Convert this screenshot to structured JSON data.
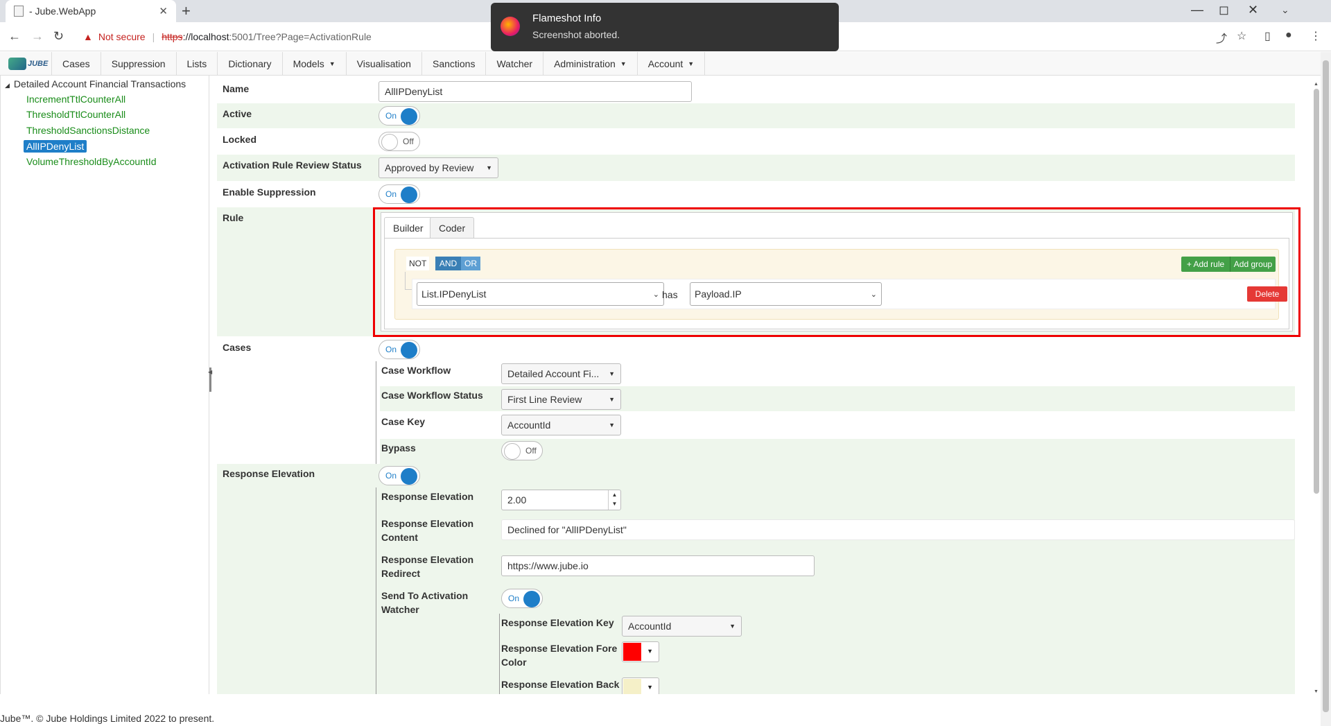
{
  "browser": {
    "tab_title": "- Jube.WebApp",
    "new_tab": "+",
    "url_warning": "Not secure",
    "url_scheme": "https",
    "url_host": "://localhost",
    "url_path": ":5001/Tree?Page=ActivationRule"
  },
  "toast": {
    "title": "Flameshot Info",
    "message": "Screenshot aborted."
  },
  "brand": {
    "text": "JUBE"
  },
  "menu": {
    "cases": "Cases",
    "suppression": "Suppression",
    "lists": "Lists",
    "dictionary": "Dictionary",
    "models": "Models",
    "visualisation": "Visualisation",
    "sanctions": "Sanctions",
    "watcher": "Watcher",
    "administration": "Administration",
    "account": "Account"
  },
  "tree": {
    "root": "Detailed Account Financial Transactions",
    "items": [
      "IncrementTtlCounterAll",
      "ThresholdTtlCounterAll",
      "ThresholdSanctionsDistance",
      "AllIPDenyList",
      "VolumeThresholdByAccountId"
    ]
  },
  "form": {
    "name_label": "Name",
    "name_value": "AllIPDenyList",
    "active_label": "Active",
    "locked_label": "Locked",
    "review_label": "Activation Rule Review Status",
    "review_value": "Approved by Review",
    "suppression_label": "Enable Suppression",
    "rule_label": "Rule",
    "cases_label": "Cases",
    "workflow_label": "Case Workflow",
    "workflow_value": "Detailed Account Fi...",
    "workflow_status_label": "Case Workflow Status",
    "workflow_status_value": "First Line Review",
    "case_key_label": "Case Key",
    "case_key_value": "AccountId",
    "bypass_label": "Bypass",
    "resp_elev_section": "Response Elevation",
    "resp_elev_label": "Response Elevation",
    "resp_elev_value": "2.00",
    "resp_content_label": "Response Elevation Content",
    "resp_content_value": "Declined for \"AllIPDenyList\"",
    "resp_redirect_label": "Response Elevation Redirect",
    "resp_redirect_value": "https://www.jube.io",
    "send_watcher_label": "Send To Activation Watcher",
    "resp_key_label": "Response Elevation Key",
    "resp_key_value": "AccountId",
    "fore_color_label": "Response Elevation Fore Color",
    "back_color_label": "Response Elevation Back Color"
  },
  "toggles": {
    "on": "On",
    "off": "Off"
  },
  "rule_builder": {
    "tab_builder": "Builder",
    "tab_coder": "Coder",
    "not": "NOT",
    "and": "AND",
    "or": "OR",
    "add_rule": "+ Add rule",
    "add_group": "Add group",
    "field": "List.IPDenyList",
    "operator": "has",
    "value": "Payload.IP",
    "delete": "Delete"
  },
  "colors": {
    "fore": "#ff0000",
    "back": "#f5f0c8",
    "accent": "#1e7ec8"
  },
  "footer": "Jube™. © Jube Holdings Limited 2022 to present."
}
